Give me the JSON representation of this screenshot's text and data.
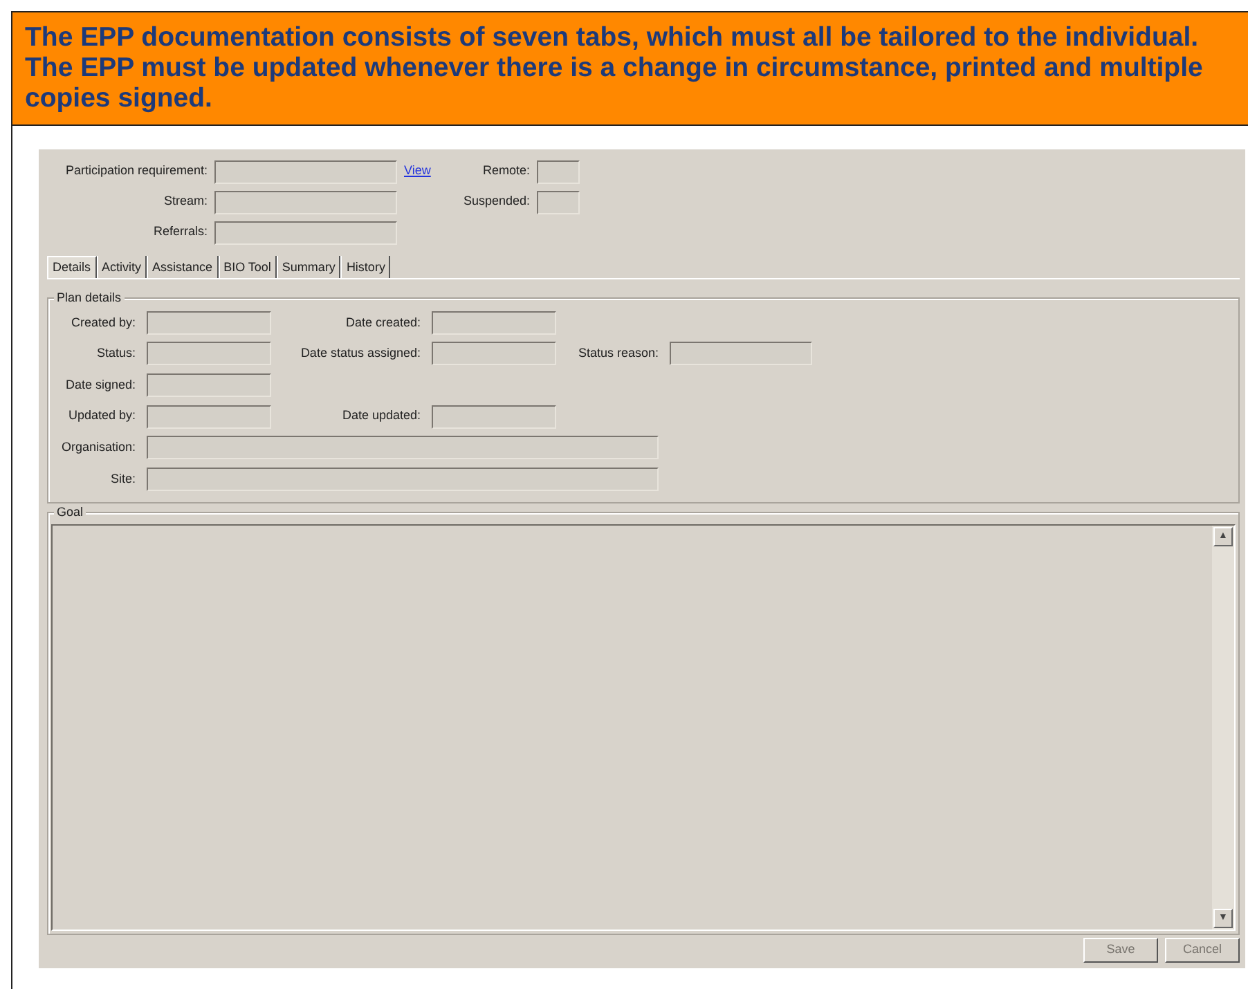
{
  "banner": {
    "text": "The EPP documentation consists of seven tabs, which must all be tailored to the individual. The EPP must be updated whenever there is a change in circumstance, printed and multiple copies signed."
  },
  "top_rows": [
    {
      "label": "Participation requirement:",
      "link": "View",
      "side": {
        "label": "Remote:"
      }
    },
    {
      "label": "Stream:",
      "side": {
        "label": "Suspended:"
      }
    },
    {
      "label": "Referrals:"
    }
  ],
  "tabs": [
    {
      "label": "Details",
      "selected": true
    },
    {
      "label": "Activity",
      "selected": false
    },
    {
      "label": "Assistance",
      "selected": false
    },
    {
      "label": "BIO Tool",
      "selected": false
    },
    {
      "label": "Summary",
      "selected": false
    },
    {
      "label": "History",
      "selected": false
    }
  ],
  "plan_details": {
    "title": "Plan details",
    "rows": [
      [
        {
          "label": "Created by:",
          "kind": "short"
        },
        {
          "label": "Date created:",
          "kind": "short"
        }
      ],
      [
        {
          "label": "Status:",
          "kind": "short"
        },
        {
          "label": "Date status assigned:",
          "kind": "short"
        },
        {
          "label": "Status reason:",
          "kind": "short"
        }
      ],
      [
        {
          "label": "Date signed:",
          "kind": "short"
        }
      ],
      [
        {
          "label": "Updated by:",
          "kind": "short"
        },
        {
          "label": "Date updated:",
          "kind": "short"
        }
      ],
      [
        {
          "label": "Organisation:",
          "kind": "wide"
        }
      ],
      [
        {
          "label": "Site:",
          "kind": "wide"
        }
      ]
    ]
  },
  "goal": {
    "title": "Goal",
    "scroll_up": "▲",
    "scroll_down": "▼"
  },
  "buttons": [
    {
      "label": "Save",
      "disabled": true
    },
    {
      "label": "Cancel",
      "disabled": true
    }
  ]
}
